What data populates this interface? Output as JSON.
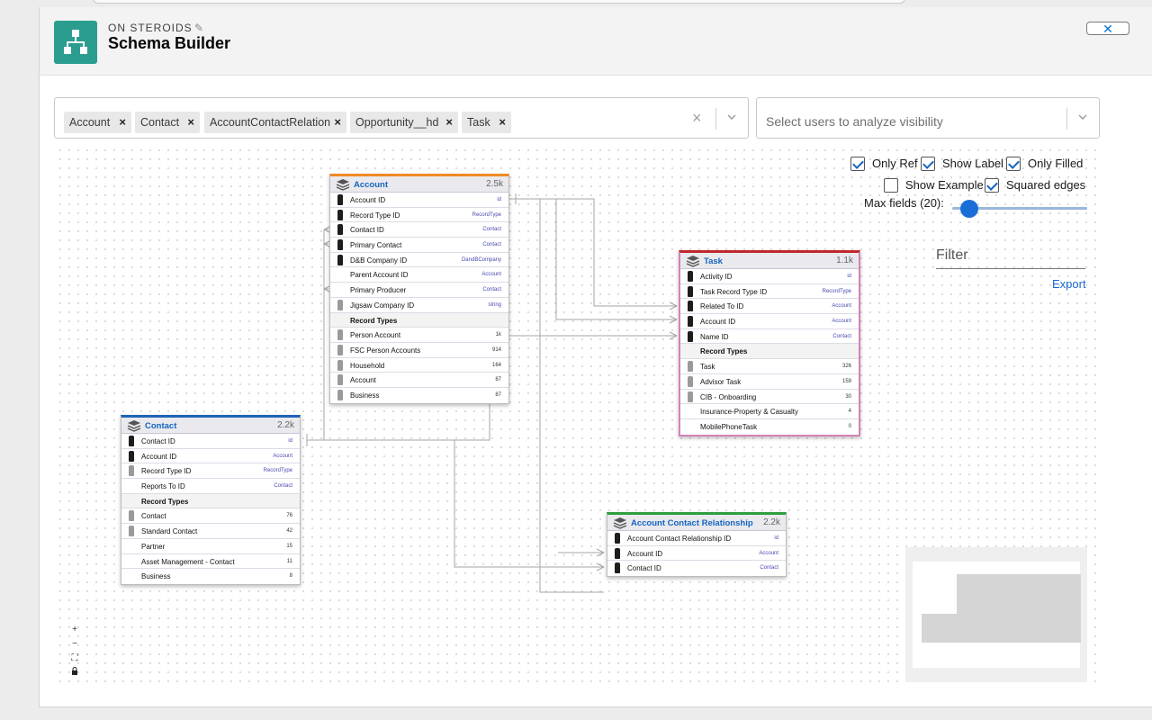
{
  "header": {
    "eyebrow": "ON STEROIDS",
    "title": "Schema Builder",
    "close_label": "✕"
  },
  "objects_select": {
    "pills": [
      {
        "label": "Account"
      },
      {
        "label": "Contact"
      },
      {
        "label": "AccountContactRelation"
      },
      {
        "label": "Opportunity__hd"
      },
      {
        "label": "Task"
      }
    ],
    "remove_glyph": "×",
    "clear_glyph": "×"
  },
  "users_select": {
    "placeholder": "Select users to analyze visibility"
  },
  "options": {
    "only_ref": {
      "label": "Only Ref",
      "checked": true
    },
    "show_label": {
      "label": "Show Label",
      "checked": true
    },
    "only_filled": {
      "label": "Only Filled",
      "checked": true
    },
    "show_example": {
      "label": "Show Example",
      "checked": false
    },
    "squared_edges": {
      "label": "Squared edges",
      "checked": true
    },
    "max_fields_label": "Max fields (20):",
    "max_fields_value": 20,
    "filter_label": "Filter",
    "export_label": "Export"
  },
  "nodes": {
    "account": {
      "name": "Account",
      "count": "2.5k",
      "color": "#f08a24",
      "fields": [
        {
          "label": "Account ID",
          "value": "id",
          "icon": "dark"
        },
        {
          "label": "Record Type ID",
          "value": "RecordType",
          "icon": "dark"
        },
        {
          "label": "Contact ID",
          "value": "Contact",
          "icon": "dark"
        },
        {
          "label": "Primary Contact",
          "value": "Contact",
          "icon": "dark"
        },
        {
          "label": "D&B Company ID",
          "value": "DandBCompany",
          "icon": "dark"
        },
        {
          "label": "Parent Account ID",
          "value": "Account",
          "icon": "none"
        },
        {
          "label": "Primary Producer",
          "value": "Contact",
          "icon": "none"
        },
        {
          "label": "Jigsaw Company ID",
          "value": "string",
          "icon": "grey"
        }
      ],
      "record_types_label": "Record Types",
      "record_types": [
        {
          "label": "Person Account",
          "value": "1k",
          "icon": "grey"
        },
        {
          "label": "FSC Person Accounts",
          "value": "914",
          "icon": "grey"
        },
        {
          "label": "Household",
          "value": "164",
          "icon": "grey"
        },
        {
          "label": "Account",
          "value": "87",
          "icon": "grey"
        },
        {
          "label": "Business",
          "value": "87",
          "icon": "grey"
        }
      ]
    },
    "task": {
      "name": "Task",
      "count": "1.1k",
      "color": "#c0282d",
      "fields": [
        {
          "label": "Activity ID",
          "value": "id",
          "icon": "dark"
        },
        {
          "label": "Task Record Type ID",
          "value": "RecordType",
          "icon": "dark"
        },
        {
          "label": "Related To ID",
          "value": "Account",
          "icon": "dark"
        },
        {
          "label": "Account ID",
          "value": "Account",
          "icon": "dark"
        },
        {
          "label": "Name ID",
          "value": "Contact",
          "icon": "dark"
        }
      ],
      "record_types_label": "Record Types",
      "record_types": [
        {
          "label": "Task",
          "value": "326",
          "icon": "grey"
        },
        {
          "label": "Advisor Task",
          "value": "159",
          "icon": "grey"
        },
        {
          "label": "CIB - Onboarding",
          "value": "30",
          "icon": "grey"
        },
        {
          "label": "Insurance-Property & Casualty",
          "value": "4",
          "icon": "none"
        },
        {
          "label": "MobilePhoneTask",
          "value": "0",
          "icon": "none"
        }
      ]
    },
    "contact": {
      "name": "Contact",
      "count": "2.2k",
      "color": "#1e63b8",
      "fields": [
        {
          "label": "Contact ID",
          "value": "id",
          "icon": "dark"
        },
        {
          "label": "Account ID",
          "value": "Account",
          "icon": "dark"
        },
        {
          "label": "Record Type ID",
          "value": "RecordType",
          "icon": "grey"
        },
        {
          "label": "Reports To ID",
          "value": "Contact",
          "icon": "none"
        }
      ],
      "record_types_label": "Record Types",
      "record_types": [
        {
          "label": "Contact",
          "value": "76",
          "icon": "grey"
        },
        {
          "label": "Standard Contact",
          "value": "42",
          "icon": "grey"
        },
        {
          "label": "Partner",
          "value": "15",
          "icon": "none"
        },
        {
          "label": "Asset Management - Contact",
          "value": "11",
          "icon": "none"
        },
        {
          "label": "Business",
          "value": "8",
          "icon": "none"
        }
      ]
    },
    "acr": {
      "name": "Account Contact Relationship",
      "count": "2.2k",
      "color": "#2e9e3e",
      "fields": [
        {
          "label": "Account Contact Relationship ID",
          "value": "id",
          "icon": "dark"
        },
        {
          "label": "Account ID",
          "value": "Account",
          "icon": "dark"
        },
        {
          "label": "Contact ID",
          "value": "Contact",
          "icon": "dark"
        }
      ]
    }
  },
  "zoom_controls": {
    "zoom_in": "+",
    "zoom_out": "−",
    "fit": "⛶",
    "lock": "🔒"
  }
}
